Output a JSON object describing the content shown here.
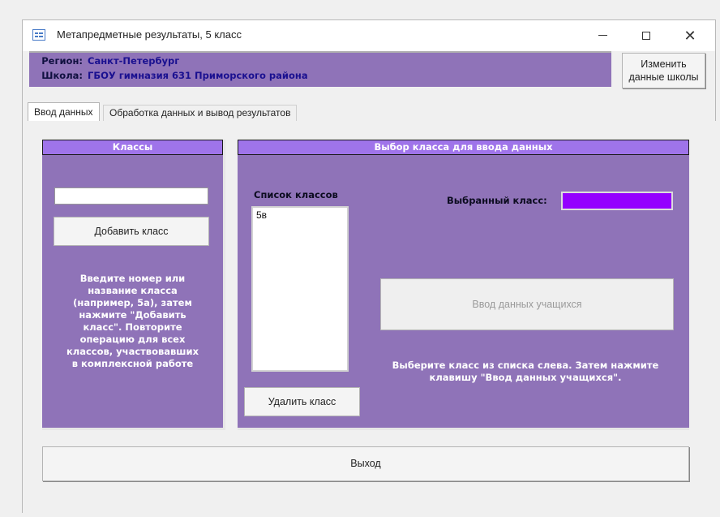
{
  "window": {
    "title": "Метапредметные результаты, 5 класс",
    "minimize_glyph": "",
    "close_glyph": "✕"
  },
  "header": {
    "region_label": "Регион:",
    "region_value": "Санкт-Петербург",
    "school_label": "Школа:",
    "school_value": "ГБОУ гимназия 631 Приморского района",
    "change_button": "Изменить данные школы"
  },
  "tabs": [
    {
      "label": "Ввод данных",
      "active": true
    },
    {
      "label": "Обработка данных и вывод результатов",
      "active": false
    }
  ],
  "left_panel": {
    "title": "Классы",
    "input_value": "",
    "add_button": "Добавить класс",
    "instructions": "Введите номер или\nназвание класса\n(например, 5а), затем\nнажмите \"Добавить\nкласс\". Повторите\nоперацию для всех\nклассов, участвовавших\nв комплексной работе"
  },
  "right_panel": {
    "title": "Выбор класса для ввода данных",
    "list_label": "Список классов",
    "classes": [
      "5в"
    ],
    "selected_label": "Выбранный класс:",
    "selected_value": "",
    "students_button": "Ввод данных учащихся",
    "instructions": "Выберите класс из списка слева. Затем нажмите\nклавишу \"Ввод данных учащихся\".",
    "delete_button": "Удалить класс"
  },
  "footer": {
    "exit_button": "Выход"
  },
  "colors": {
    "panel": "#8f73b8",
    "panel_header": "#9f74ea",
    "selected_field": "#9400ff"
  },
  "icons": {
    "app": "form-icon",
    "minimize": "minimize-icon",
    "maximize": "maximize-icon",
    "close": "close-icon"
  }
}
